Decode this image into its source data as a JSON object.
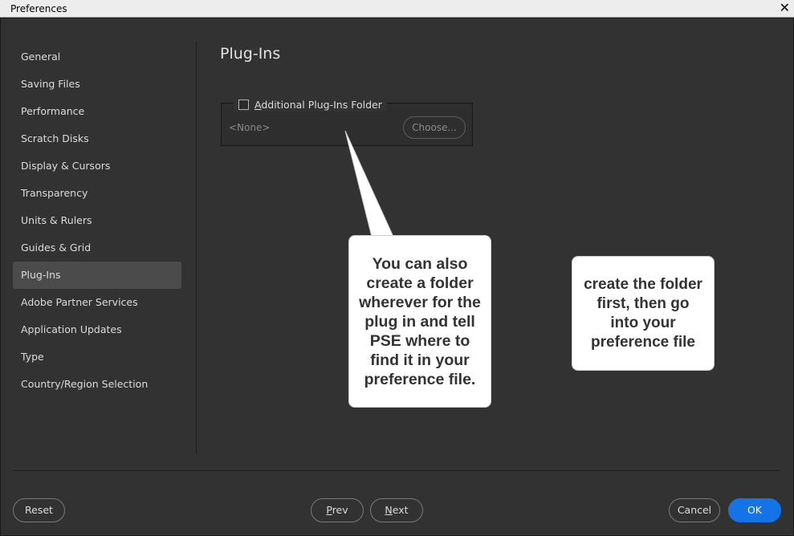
{
  "window": {
    "title": "Preferences",
    "close_glyph": "✕"
  },
  "sidebar": {
    "items": [
      {
        "label": "General"
      },
      {
        "label": "Saving Files"
      },
      {
        "label": "Performance"
      },
      {
        "label": "Scratch Disks"
      },
      {
        "label": "Display & Cursors"
      },
      {
        "label": "Transparency"
      },
      {
        "label": "Units & Rulers"
      },
      {
        "label": "Guides & Grid"
      },
      {
        "label": "Plug-Ins",
        "selected": true
      },
      {
        "label": "Adobe Partner Services"
      },
      {
        "label": "Application Updates"
      },
      {
        "label": "Type"
      },
      {
        "label": "Country/Region Selection"
      }
    ]
  },
  "main": {
    "title": "Plug-Ins",
    "plugins_folder": {
      "checkbox_label_mnemonic": "A",
      "checkbox_label_rest": "dditional Plug-Ins Folder",
      "checked": false,
      "path_value": "<None>",
      "choose_label": "Choose..."
    }
  },
  "annotations": {
    "callout1": "You can also create a folder wherever for the plug in and tell PSE where to find it in your preference file.",
    "callout2": "create the folder first, then go into your preference file"
  },
  "footer": {
    "reset_label": "Reset",
    "prev_mnemonic": "P",
    "prev_rest": "rev",
    "next_mnemonic": "N",
    "next_rest": "ext",
    "cancel_label": "Cancel",
    "ok_label": "OK"
  },
  "colors": {
    "background": "#323232",
    "selected_item": "#4b4b4b",
    "ok_button": "#1473e6",
    "callout_bg": "#ffffff"
  }
}
